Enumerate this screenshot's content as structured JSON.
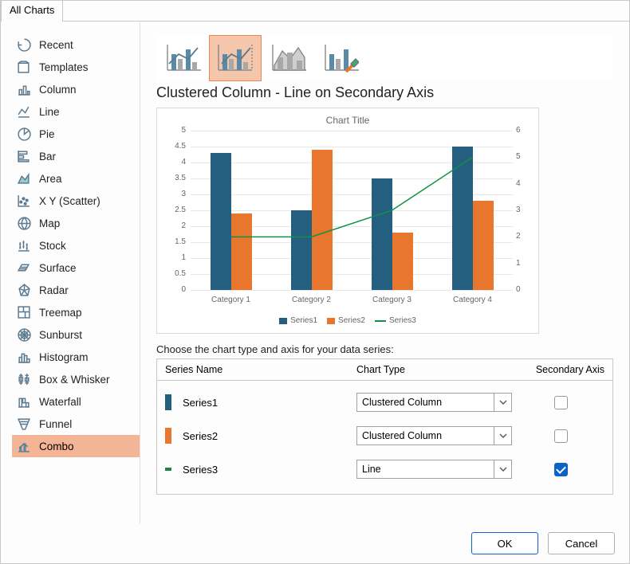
{
  "tab": "All Charts",
  "sidebar": {
    "items": [
      "Recent",
      "Templates",
      "Column",
      "Line",
      "Pie",
      "Bar",
      "Area",
      "X Y (Scatter)",
      "Map",
      "Stock",
      "Surface",
      "Radar",
      "Treemap",
      "Sunburst",
      "Histogram",
      "Box & Whisker",
      "Waterfall",
      "Funnel",
      "Combo"
    ],
    "active": "Combo"
  },
  "subtype_icons": [
    "combo-col-line",
    "combo-col-line-sec",
    "combo-area",
    "combo-custom"
  ],
  "heading": "Clustered Column - Line on Secondary Axis",
  "preview_title": "Chart Title",
  "choose_text": "Choose the chart type and axis for your data series:",
  "table": {
    "headers": [
      "Series Name",
      "Chart Type",
      "Secondary Axis"
    ],
    "series": [
      {
        "name": "Series1",
        "type": "Clustered Column",
        "color": "#245f80",
        "secondary": false,
        "swatch": "bar"
      },
      {
        "name": "Series2",
        "type": "Clustered Column",
        "color": "#e8762d",
        "secondary": false,
        "swatch": "bar"
      },
      {
        "name": "Series3",
        "type": "Line",
        "color": "#1e8449",
        "secondary": true,
        "swatch": "line"
      }
    ]
  },
  "buttons": {
    "ok": "OK",
    "cancel": "Cancel"
  },
  "chart_data": {
    "type": "bar",
    "title": "Chart Title",
    "categories": [
      "Category 1",
      "Category 2",
      "Category 3",
      "Category 4"
    ],
    "y_primary": {
      "min": 0,
      "max": 5,
      "step": 0.5,
      "ticks": [
        0,
        0.5,
        1,
        1.5,
        2,
        2.5,
        3,
        3.5,
        4,
        4.5,
        5
      ]
    },
    "y_secondary": {
      "min": 0,
      "max": 6,
      "step": 1,
      "ticks": [
        0,
        1,
        2,
        3,
        4,
        5,
        6
      ]
    },
    "series": [
      {
        "name": "Series1",
        "type": "bar",
        "axis": "primary",
        "color": "#245f80",
        "values": [
          4.3,
          2.5,
          3.5,
          4.5
        ]
      },
      {
        "name": "Series2",
        "type": "bar",
        "axis": "primary",
        "color": "#e8762d",
        "values": [
          2.4,
          4.4,
          1.8,
          2.8
        ]
      },
      {
        "name": "Series3",
        "type": "line",
        "axis": "secondary",
        "color": "#119046",
        "values": [
          2.0,
          2.0,
          3.0,
          5.0
        ]
      }
    ],
    "legend_labels": [
      "Series1",
      "Series2",
      "Series3"
    ]
  }
}
